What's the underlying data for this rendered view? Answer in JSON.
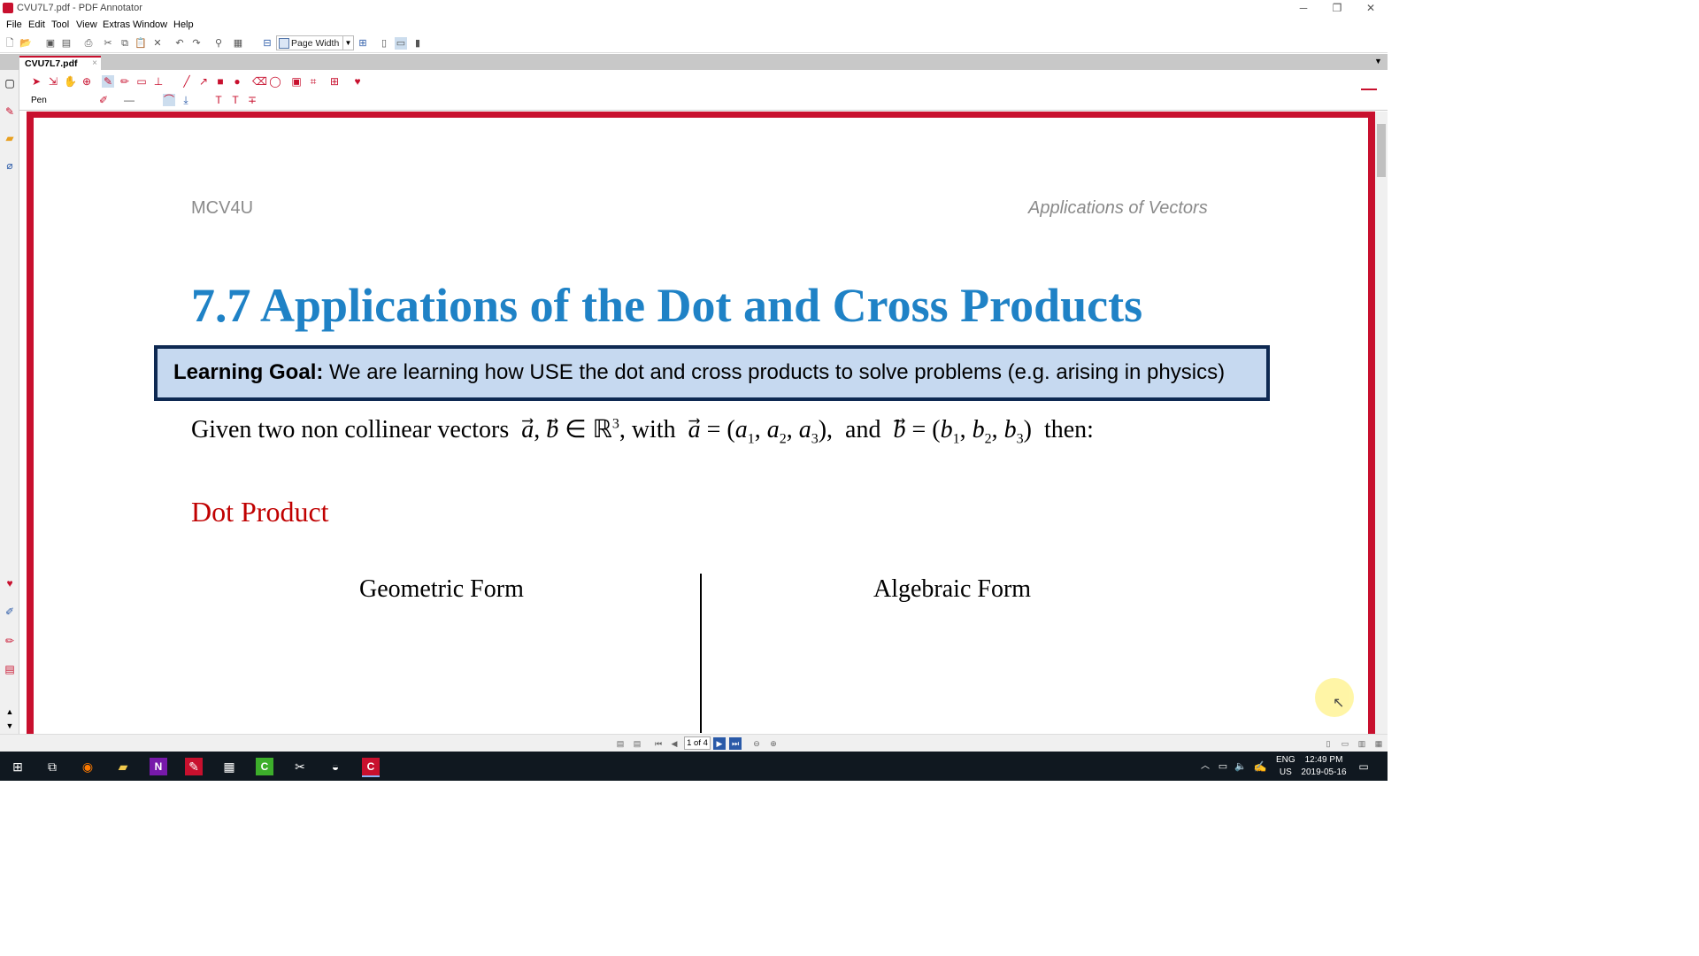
{
  "window": {
    "title": "CVU7L7.pdf - PDF Annotator"
  },
  "menu": [
    "File",
    "Edit",
    "Tool",
    "View",
    "Extras",
    "Window",
    "Help"
  ],
  "toolbar": {
    "zoom_label": "Page Width"
  },
  "tab": {
    "label": "CVU7L7.pdf"
  },
  "annot": {
    "tool_label": "Pen"
  },
  "doc": {
    "header_left": "MCV4U",
    "header_right": "Applications of Vectors",
    "title": "7.7 Applications of the Dot and Cross Products",
    "goal_bold": "Learning Goal:",
    "goal_text": "We are learning how USE the dot and cross products to solve problems (e.g. arising in physics)",
    "given_intro": "Given two non collinear vectors",
    "given_end": "then:",
    "section": "Dot Product",
    "col_left": "Geometric Form",
    "col_right": "Algebraic Form"
  },
  "status": {
    "page_indicator": "1 of 4"
  },
  "taskbar": {
    "lang": "ENG",
    "region": "US",
    "time": "12:49 PM",
    "date": "2019-05-16"
  },
  "colors": {
    "accent": "#c8102e",
    "title_blue": "#1f82c6",
    "goal_bg": "#c6d9f0",
    "goal_border": "#0e2952",
    "section_red": "#c00000"
  }
}
